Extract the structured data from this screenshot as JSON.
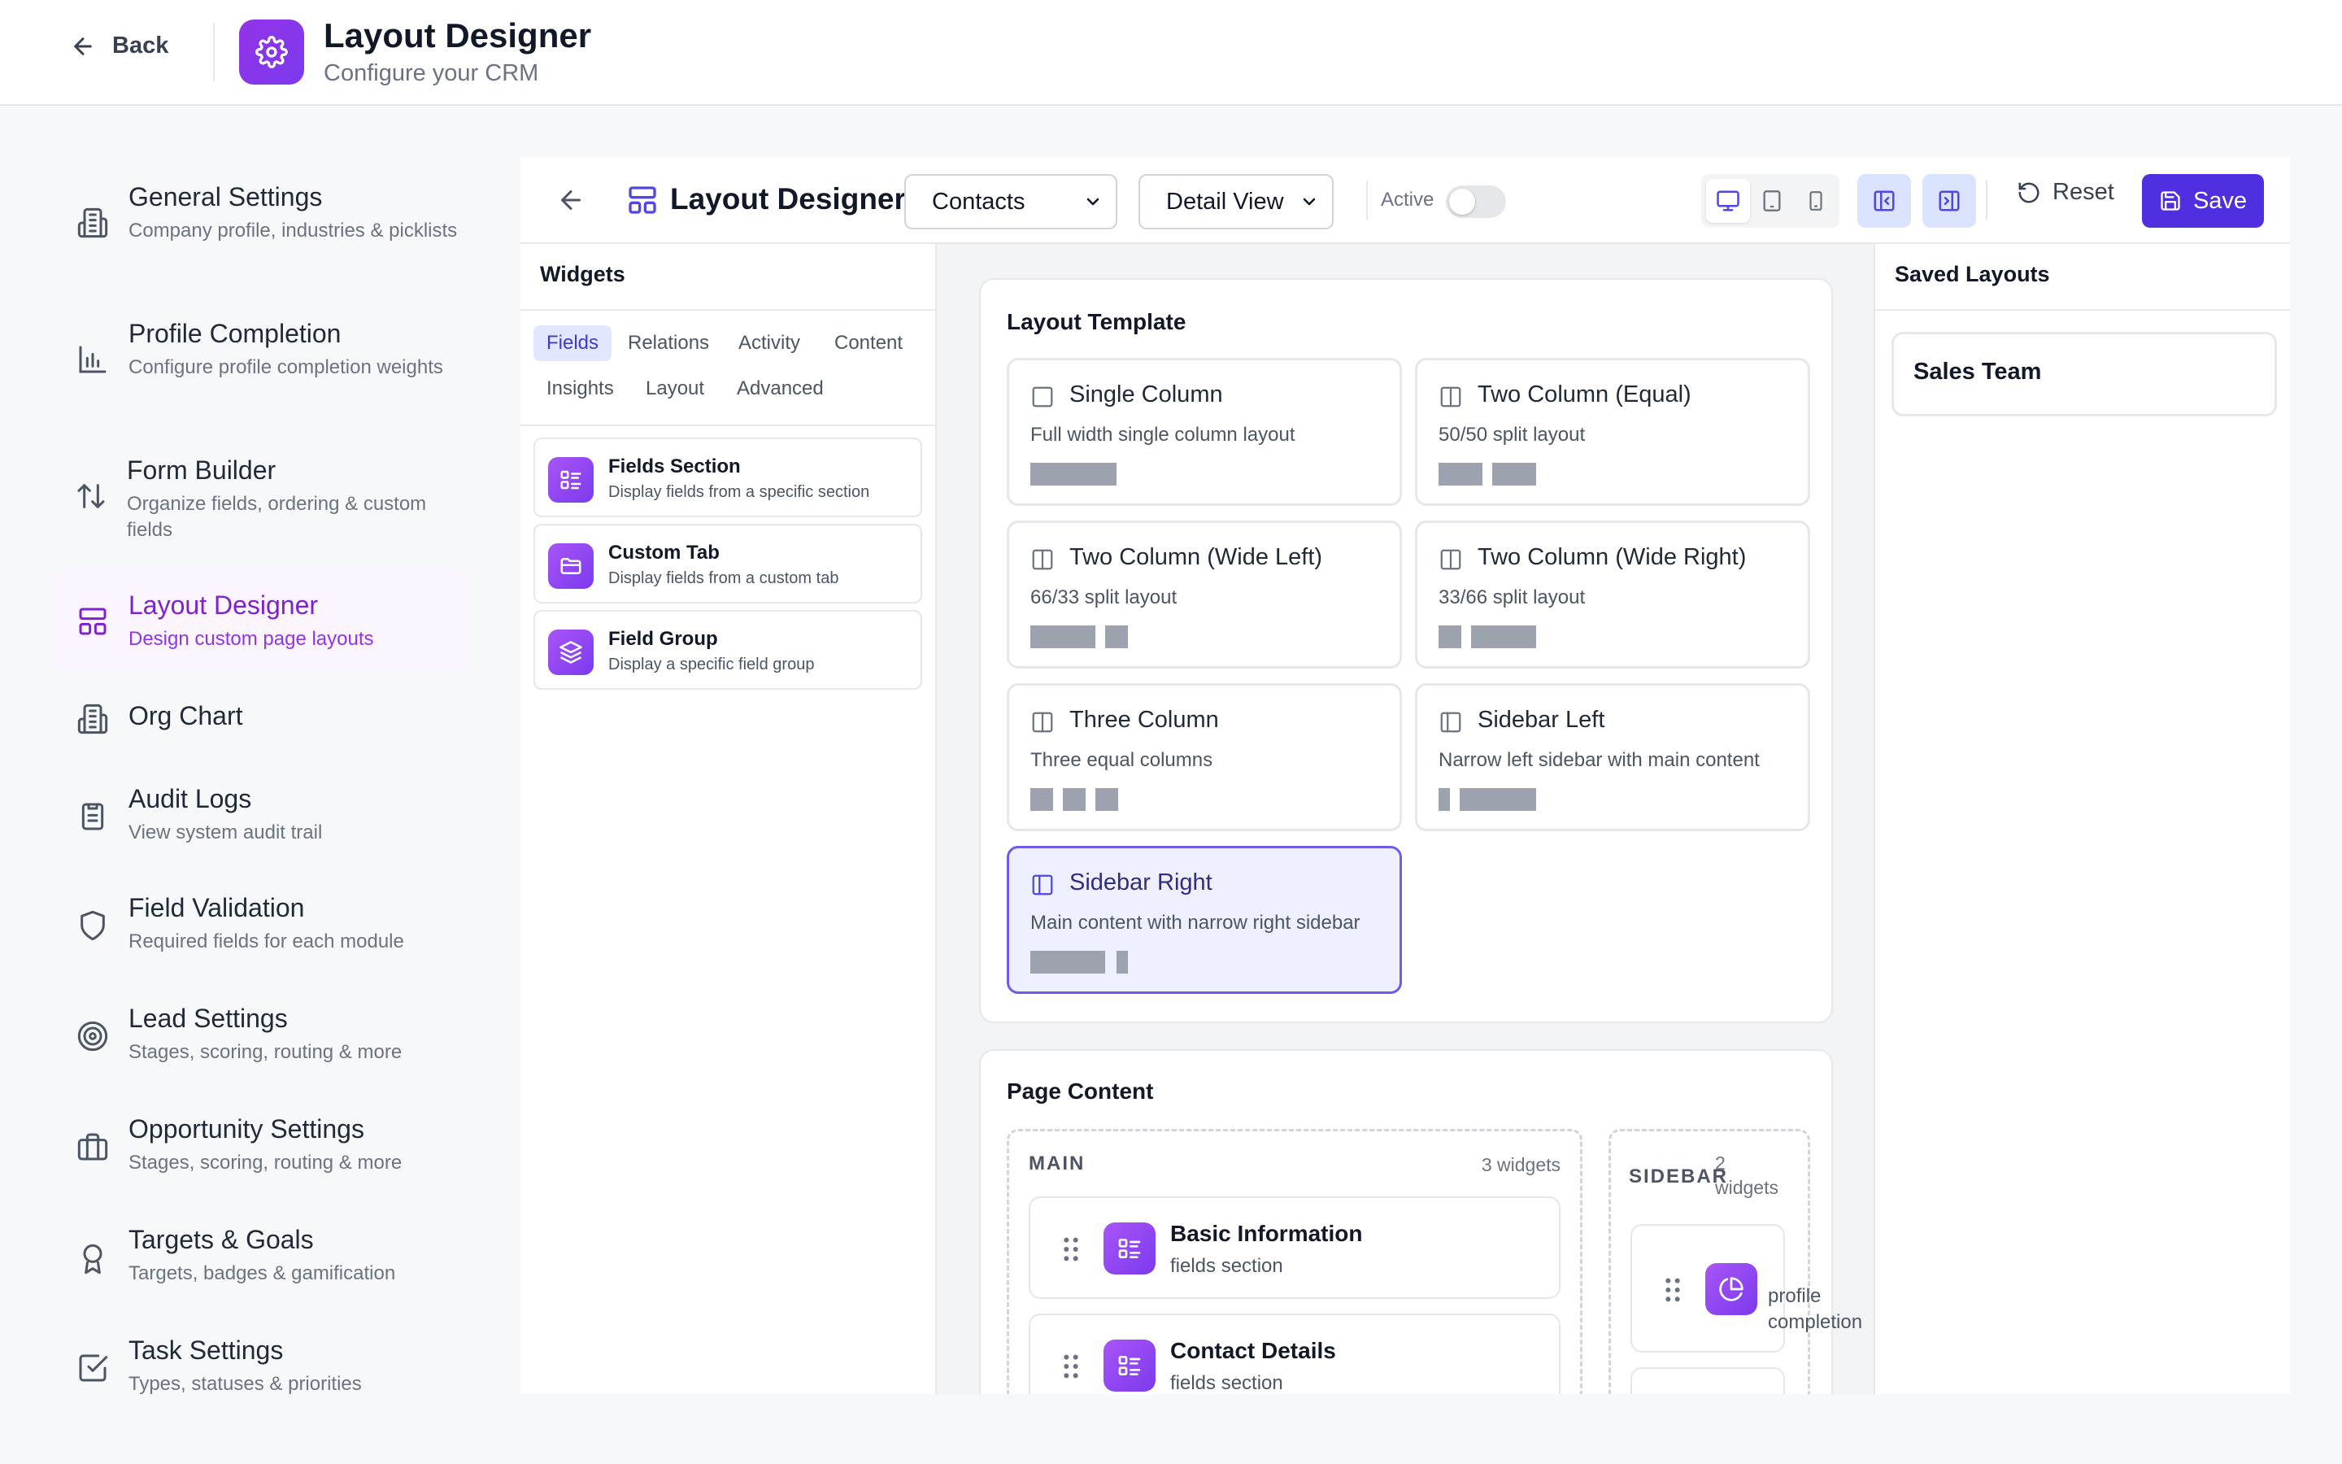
{
  "header": {
    "back_label": "Back",
    "app_title": "Layout Designer",
    "app_subtitle": "Configure your CRM"
  },
  "nav": [
    {
      "title": "General Settings",
      "desc": "Company profile, industries & picklists",
      "icon": "building-icon"
    },
    {
      "title": "Profile Completion",
      "desc": "Configure profile completion weights",
      "icon": "bar-chart-icon"
    },
    {
      "title": "Form Builder",
      "desc": "Organize fields, ordering & custom fields",
      "icon": "sort-arrows-icon"
    },
    {
      "title": "Layout Designer",
      "desc": "Design custom page layouts",
      "icon": "layout-icon",
      "active": true
    },
    {
      "title": "Org Chart",
      "desc": "",
      "icon": "building-icon"
    },
    {
      "title": "Audit Logs",
      "desc": "View system audit trail",
      "icon": "clipboard-icon"
    },
    {
      "title": "Field Validation",
      "desc": "Required fields for each module",
      "icon": "shield-icon"
    },
    {
      "title": "Lead Settings",
      "desc": "Stages, scoring, routing & more",
      "icon": "target-icon"
    },
    {
      "title": "Opportunity Settings",
      "desc": "Stages, scoring, routing & more",
      "icon": "briefcase-icon"
    },
    {
      "title": "Targets & Goals",
      "desc": "Targets, badges & gamification",
      "icon": "award-icon"
    },
    {
      "title": "Task Settings",
      "desc": "Types, statuses & priorities",
      "icon": "checkbox-icon"
    }
  ],
  "toolbar": {
    "title": "Layout Designer",
    "module_select": "Contacts",
    "view_select": "Detail View",
    "active_label": "Active",
    "active": false,
    "reset_label": "Reset",
    "save_label": "Save",
    "selected_device": "desktop"
  },
  "widgets": {
    "heading": "Widgets",
    "tabs": [
      "Fields",
      "Relations",
      "Activity",
      "Content",
      "Insights",
      "Layout",
      "Advanced"
    ],
    "active_tab": "Fields",
    "items": [
      {
        "title": "Fields Section",
        "desc": "Display fields from a specific section",
        "icon": "list-icon"
      },
      {
        "title": "Custom Tab",
        "desc": "Display fields from a custom tab",
        "icon": "folder-icon"
      },
      {
        "title": "Field Group",
        "desc": "Display a specific field group",
        "icon": "layers-icon"
      }
    ]
  },
  "layout_template": {
    "heading": "Layout Template",
    "selected": "Sidebar Right",
    "templates": [
      {
        "name": "Single Column",
        "desc": "Full width single column layout"
      },
      {
        "name": "Two Column (Equal)",
        "desc": "50/50 split layout"
      },
      {
        "name": "Two Column (Wide Left)",
        "desc": "66/33 split layout"
      },
      {
        "name": "Two Column (Wide Right)",
        "desc": "33/66 split layout"
      },
      {
        "name": "Three Column",
        "desc": "Three equal columns"
      },
      {
        "name": "Sidebar Left",
        "desc": "Narrow left sidebar with main content"
      },
      {
        "name": "Sidebar Right",
        "desc": "Main content with narrow right sidebar"
      }
    ]
  },
  "page_content": {
    "heading": "Page Content",
    "main": {
      "label": "MAIN",
      "count": "3 widgets",
      "widgets": [
        {
          "title": "Basic Information",
          "sub": "fields section"
        },
        {
          "title": "Contact Details",
          "sub": "fields section"
        }
      ]
    },
    "sidebar": {
      "label": "SIDEBAR",
      "count_num": "2",
      "count_word": "widgets",
      "widgets": [
        {
          "sub_line1": "profile",
          "sub_line2": "completion"
        }
      ]
    }
  },
  "saved_layouts": {
    "heading": "Saved Layouts",
    "items": [
      "Sales Team"
    ]
  }
}
